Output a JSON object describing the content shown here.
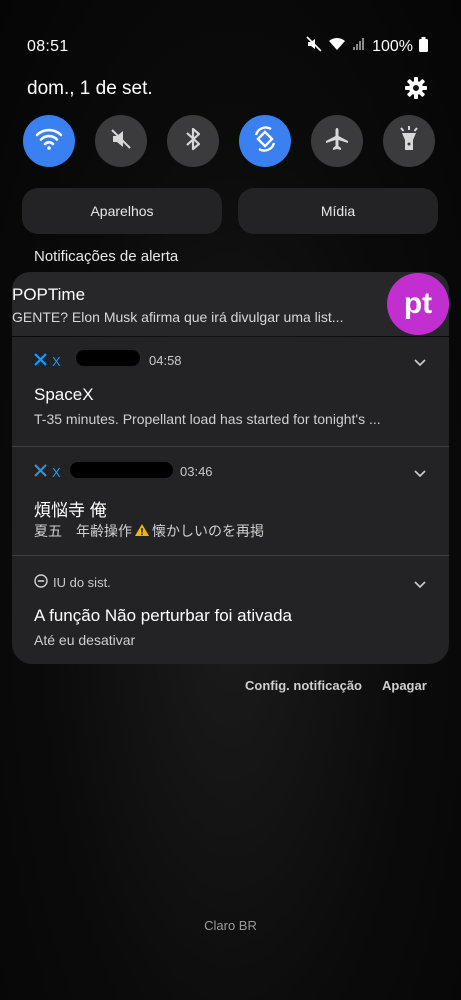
{
  "status_bar": {
    "time": "08:51",
    "battery": "100%"
  },
  "panel": {
    "date": "dom., 1 de set.",
    "toggles": [
      {
        "name": "wifi",
        "state": "on"
      },
      {
        "name": "sound-mute",
        "state": "off"
      },
      {
        "name": "bluetooth",
        "state": "off"
      },
      {
        "name": "auto-rotate",
        "state": "on"
      },
      {
        "name": "airplane",
        "state": "off"
      },
      {
        "name": "flashlight",
        "state": "off"
      }
    ],
    "devices_label": "Aparelhos",
    "media_label": "Mídia",
    "alert_heading": "Notificações de alerta"
  },
  "notifications": {
    "poptime": {
      "title": "POPTime",
      "body": "GENTE? Elon Musk afirma que irá divulgar uma list...",
      "avatar_text": "pt"
    },
    "x1": {
      "app": "X",
      "time": "04:58",
      "title": "SpaceX",
      "body": "T-35 minutes. Propellant load has started for tonight's ..."
    },
    "x2": {
      "app": "X",
      "time": "03:46",
      "title": "煩悩寺 俺",
      "body_prefix": "夏五　年齢操作",
      "body_suffix": "懐かしいのを再掲"
    },
    "system": {
      "app": "IU do sist.",
      "title": "A função Não perturbar foi ativada",
      "body": "Até eu desativar"
    }
  },
  "footer": {
    "config_label": "Config. notificação",
    "clear_label": "Apagar",
    "carrier": "Claro BR"
  },
  "colors": {
    "accent": "#3a80f0",
    "x_blue": "#1d9bf0",
    "avatar": "#c12fd0"
  }
}
